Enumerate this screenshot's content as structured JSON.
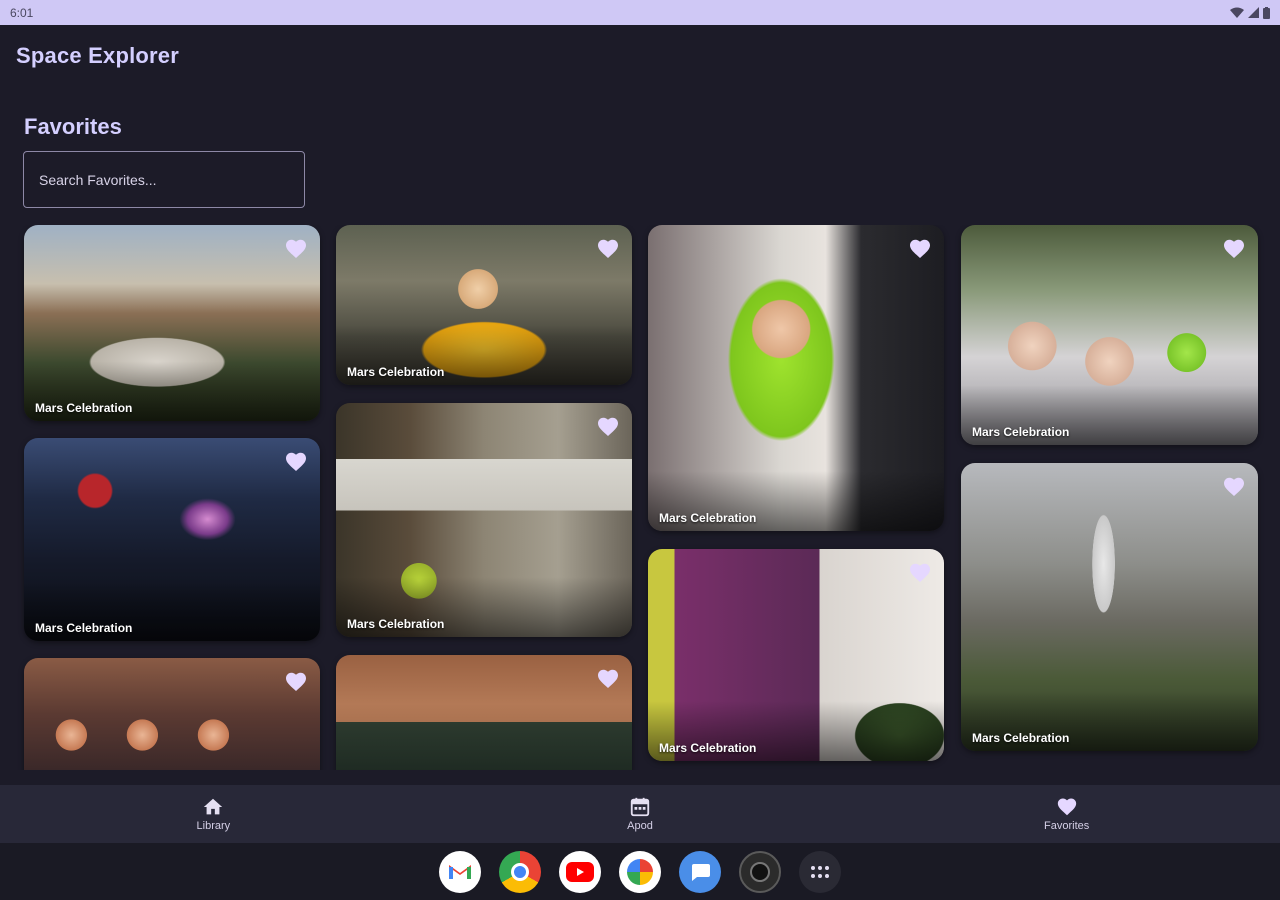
{
  "status_bar": {
    "time": "6:01"
  },
  "app": {
    "title": "Space Explorer"
  },
  "favorites": {
    "heading": "Favorites",
    "search_placeholder": "Search Favorites...",
    "cards": [
      {
        "caption": "Mars Celebration",
        "image": "crowd-ufo-sculpture"
      },
      {
        "caption": "Mars Celebration",
        "image": "girl-sun-costume"
      },
      {
        "caption": "Mars Celebration",
        "image": "woman-green-wig-microphone"
      },
      {
        "caption": "Mars Celebration",
        "image": "parade-silver-costumes"
      },
      {
        "caption": "Mars Celebration",
        "image": "night-stage-concert"
      },
      {
        "caption": "Mars Celebration",
        "image": "child-robot-box-costume"
      },
      {
        "caption": "Mars Celebration",
        "image": "upmc-primary-care-sign"
      },
      {
        "caption": "Mars Celebration",
        "image": "stilt-walker-crowd"
      },
      {
        "caption": "",
        "image": "astronaut-figures-photo"
      },
      {
        "caption": "",
        "image": "green-truck-storefront"
      }
    ]
  },
  "bottom_nav": {
    "items": [
      {
        "label": "Library",
        "icon": "home-icon"
      },
      {
        "label": "Apod",
        "icon": "calendar-icon"
      },
      {
        "label": "Favorites",
        "icon": "heart-icon"
      }
    ]
  },
  "dock": {
    "apps": [
      "gmail-icon",
      "chrome-icon",
      "youtube-icon",
      "photos-icon",
      "messages-icon",
      "camera-icon",
      "app-drawer-icon"
    ]
  },
  "colors": {
    "background": "#1c1b28",
    "accent": "#d4cfff",
    "heart": "#e5d7ff",
    "nav_bar": "#282838",
    "status_bar": "#cfc8f5"
  }
}
